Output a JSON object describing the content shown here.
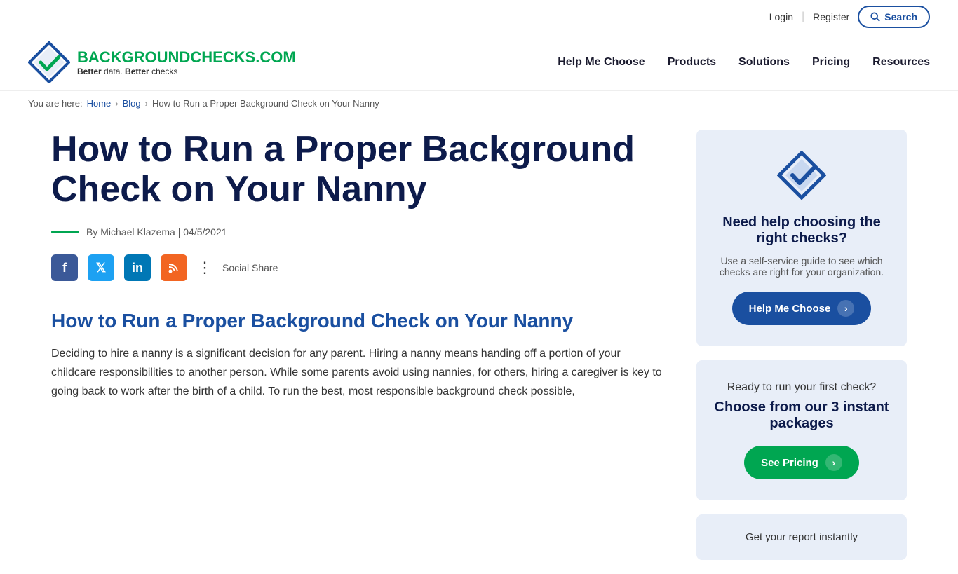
{
  "header": {
    "login_label": "Login",
    "register_label": "Register",
    "search_label": "Search",
    "brand_name_part1": "BACKGROUND",
    "brand_name_part2": "CHECKS.COM",
    "tagline_part1": "Better",
    "tagline_text1": " data. ",
    "tagline_part2": "Better",
    "tagline_text2": " checks",
    "nav": {
      "help_me_choose": "Help Me Choose",
      "products": "Products",
      "solutions": "Solutions",
      "pricing": "Pricing",
      "resources": "Resources"
    }
  },
  "breadcrumb": {
    "you_are_here": "You are here:",
    "home": "Home",
    "blog": "Blog",
    "current": "How to Run a Proper Background Check on Your Nanny"
  },
  "article": {
    "title": "How to Run a Proper Background Check on Your Nanny",
    "author": "By Michael Klazema | 04/5/2021",
    "social_share_label": "Social Share",
    "subtitle": "How to Run a Proper Background Check on Your Nanny",
    "body": "Deciding to hire a nanny is a significant decision for any parent. Hiring a nanny means handing off a portion of your childcare responsibilities to another person. While some parents avoid using nannies, for others, hiring a caregiver is key to going back to work after the birth of a child. To run the best, most responsible background check possible,"
  },
  "sidebar": {
    "help_card": {
      "title": "Need help choosing the right checks?",
      "description": "Use a self-service guide to see which checks are right for your organization.",
      "button_label": "Help Me Choose"
    },
    "pricing_card": {
      "ready_text": "Ready to run your first check?",
      "title": "Choose from our 3 instant packages",
      "button_label": "See Pricing"
    },
    "instant_card": {
      "text": "Get your report instantly"
    }
  },
  "social": {
    "facebook": "f",
    "twitter": "t",
    "linkedin": "in",
    "rss": "rss"
  }
}
